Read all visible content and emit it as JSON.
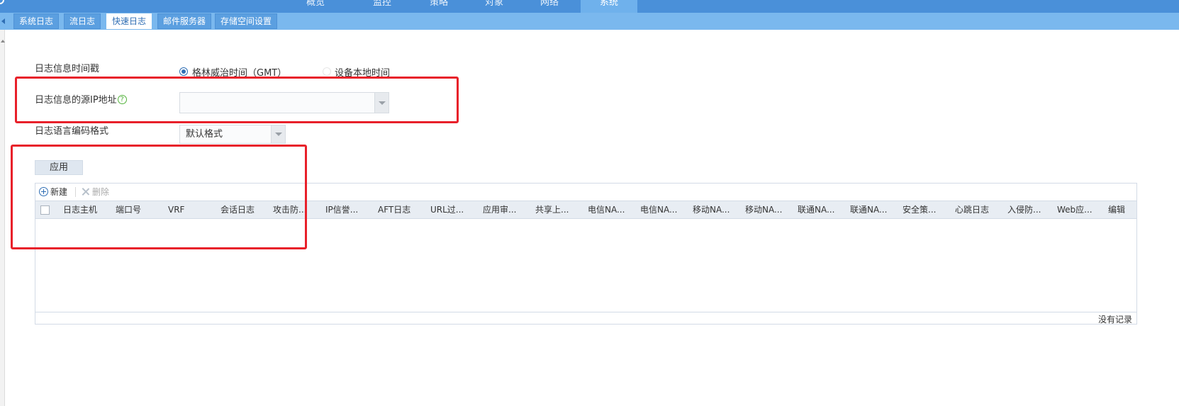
{
  "nav": {
    "items": [
      "概览",
      "监控",
      "策略",
      "对象",
      "网络",
      "系统"
    ],
    "active_index": 5
  },
  "subtabs": {
    "items": [
      "系统日志",
      "流日志",
      "快速日志",
      "邮件服务器",
      "存储空间设置"
    ],
    "active_index": 2
  },
  "form": {
    "timestamp_label": "日志信息时间戳",
    "radio_gmt": "格林威治时间（GMT）",
    "radio_local": "设备本地时间",
    "source_ip_label": "日志信息的源IP地址",
    "source_ip_value": "",
    "encoding_label": "日志语言编码格式",
    "encoding_value": "默认格式",
    "apply_label": "应用"
  },
  "table": {
    "toolbar": {
      "new_label": "新建",
      "delete_label": "删除"
    },
    "columns": [
      "日志主机",
      "端口号",
      "VRF",
      "会话日志",
      "攻击防...",
      "IP信誉...",
      "AFT日志",
      "URL过...",
      "应用审...",
      "共享上...",
      "电信NA...",
      "电信NA...",
      "移动NA...",
      "移动NA...",
      "联通NA...",
      "联通NA...",
      "安全策...",
      "心跳日志",
      "入侵防...",
      "Web应...",
      "编辑"
    ],
    "rows": [],
    "status": "没有记录"
  },
  "colors": {
    "nav_bg": "#4a90d9",
    "subtab_bg": "#7ab8ee",
    "accent": "#2f6eb4",
    "highlight_box": "#e8202a"
  }
}
